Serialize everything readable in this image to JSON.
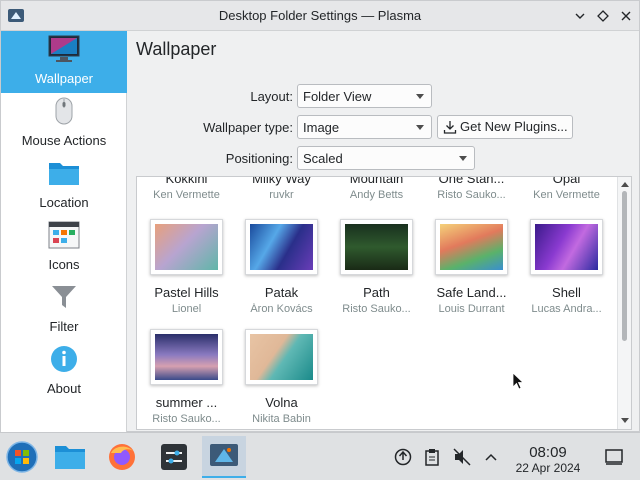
{
  "window": {
    "title": "Desktop Folder Settings — Plasma"
  },
  "sidebar": {
    "items": [
      {
        "label": "Wallpaper",
        "icon": "wallpaper-icon",
        "active": true
      },
      {
        "label": "Mouse Actions",
        "icon": "mouse-icon",
        "active": false
      },
      {
        "label": "Location",
        "icon": "folder-icon",
        "active": false
      },
      {
        "label": "Icons",
        "icon": "icons-grid-icon",
        "active": false
      },
      {
        "label": "Filter",
        "icon": "filter-icon",
        "active": false
      },
      {
        "label": "About",
        "icon": "info-icon",
        "active": false
      }
    ]
  },
  "main": {
    "title": "Wallpaper",
    "layout_label": "Layout:",
    "layout_value": "Folder View",
    "wallpaper_type_label": "Wallpaper type:",
    "wallpaper_type_value": "Image",
    "get_plugins_label": "Get New Plugins...",
    "positioning_label": "Positioning:",
    "positioning_value": "Scaled"
  },
  "wallpapers": {
    "top_row": [
      {
        "name": "Kokkini",
        "author": "Ken Vermette"
      },
      {
        "name": "Milky Way",
        "author": "ruvkr"
      },
      {
        "name": "Mountain",
        "author": "Andy Betts"
      },
      {
        "name": "One Stan...",
        "author": "Risto Sauko..."
      },
      {
        "name": "Opal",
        "author": "Ken Vermette"
      }
    ],
    "items": [
      {
        "name": "Pastel Hills",
        "author": "Lionel"
      },
      {
        "name": "Patak",
        "author": "Áron Kovács"
      },
      {
        "name": "Path",
        "author": "Risto Sauko..."
      },
      {
        "name": "Safe Land...",
        "author": "Louis Durrant"
      },
      {
        "name": "Shell",
        "author": "Lucas Andra..."
      },
      {
        "name": "summer ...",
        "author": "Risto Sauko..."
      },
      {
        "name": "Volna",
        "author": "Nikita Babin"
      }
    ]
  },
  "taskbar": {
    "apps": [
      "start-menu-icon",
      "file-manager-icon",
      "firefox-icon",
      "settings-icon",
      "plasma-settings-icon"
    ],
    "time": "08:09",
    "date": "22 Apr 2024"
  },
  "colors": {
    "accent": "#3daee9",
    "window_bg": "#eff0f1"
  }
}
